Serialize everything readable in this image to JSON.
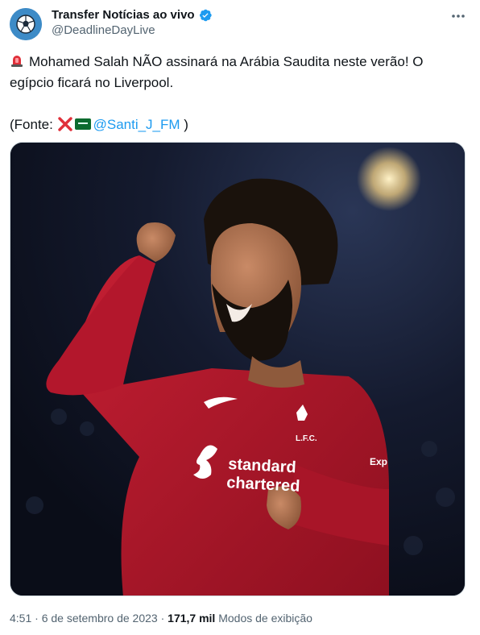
{
  "account": {
    "display_name": "Transfer Notícias ao vivo",
    "handle": "@DeadlineDayLive",
    "verified": true,
    "avatar_icon": "soccer-ball-icon"
  },
  "tweet": {
    "line1": "Mohamed Salah NÃO assinará na Arábia Saudita neste verão!  O egípcio ficará no Liverpool.",
    "source_prefix": "(Fonte: ",
    "source_mention": "@Santi_J_FM",
    "source_suffix": " )",
    "emojis": [
      "siren-icon",
      "cross-mark-icon",
      "saudi-flag-icon"
    ]
  },
  "media": {
    "alt": "Salah comemorando com a camisa do Liverpool",
    "shirt_sponsor_line1": "standard",
    "shirt_sponsor_line2": "chartered",
    "crest_text": "L.F.C.",
    "sleeve_text": "Exp"
  },
  "meta": {
    "time": "4:51",
    "date": "6 de setembro de 2023",
    "separator": "·",
    "views_count": "171,7 mil",
    "views_label": "Modos de exibição"
  },
  "colors": {
    "link": "#1d9bf0",
    "verified": "#1d9bf0",
    "shirt": "#b5162b",
    "text_secondary": "#536471"
  }
}
